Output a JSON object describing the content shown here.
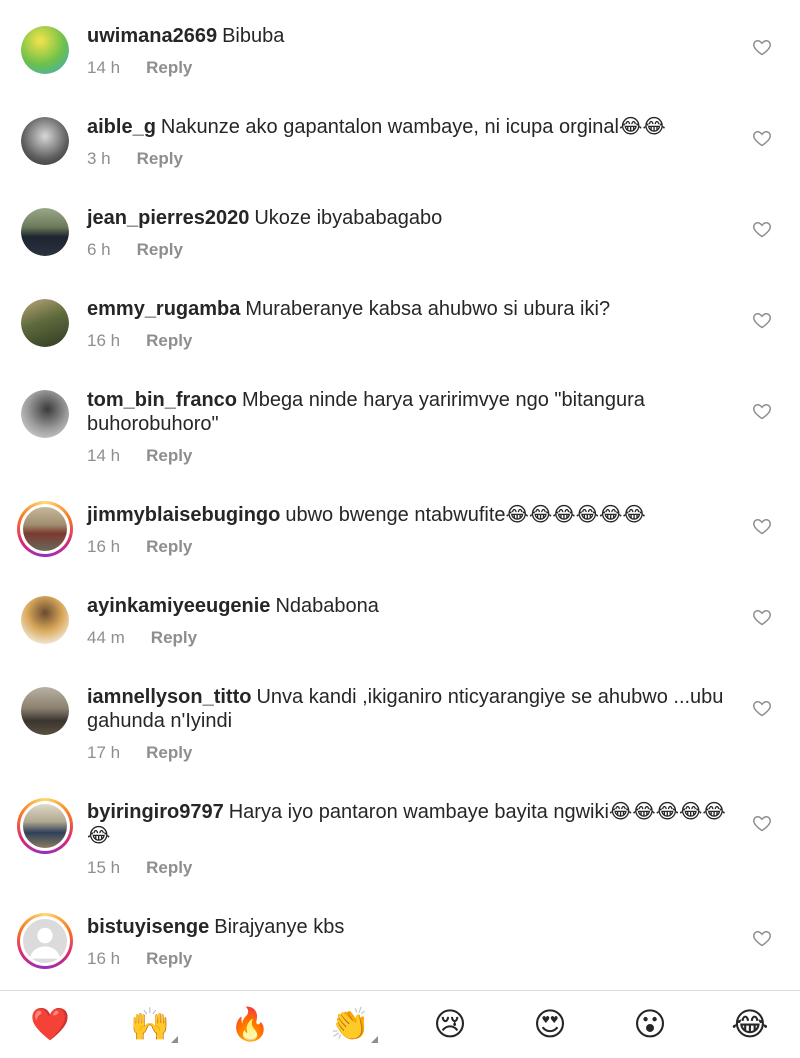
{
  "comments": [
    {
      "username": "uwimana2669",
      "text": "Bibuba",
      "time": "14 h",
      "reply": "Reply"
    },
    {
      "username": "aible_g",
      "text": "Nakunze ako gapantalon wambaye, ni icupa orginal😂😂",
      "time": "3 h",
      "reply": "Reply"
    },
    {
      "username": "jean_pierres2020",
      "text": "Ukoze ibyababagabo",
      "time": "6 h",
      "reply": "Reply"
    },
    {
      "username": "emmy_rugamba",
      "text": "Muraberanye kabsa ahubwo si ubura iki?",
      "time": "16 h",
      "reply": "Reply"
    },
    {
      "username": "tom_bin_franco",
      "text": "Mbega ninde harya yaririmvye ngo \"bitangura buhorobuhoro\"",
      "time": "14 h",
      "reply": "Reply"
    },
    {
      "username": "jimmyblaisebugingo",
      "text": "ubwo bwenge ntabwufite😂😂😂😂😂😂",
      "time": "16 h",
      "reply": "Reply"
    },
    {
      "username": "ayinkamiyeeugenie",
      "text": "Ndababona",
      "time": "44 m",
      "reply": "Reply"
    },
    {
      "username": "iamnellyson_titto",
      "text": "Unva kandi ,ikiganiro nticyarangiye se ahubwo ...ubu gahunda n'Iyindi",
      "time": "17 h",
      "reply": "Reply"
    },
    {
      "username": "byiringiro9797",
      "text": "Harya iyo pantaron wambaye bayita ngwiki😂😂😂😂😂😂",
      "time": "15 h",
      "reply": "Reply"
    },
    {
      "username": "bistuyisenge",
      "text": "Birajyanye kbs",
      "time": "16 h",
      "reply": "Reply"
    }
  ],
  "emoji_bar": [
    {
      "emoji": "❤️",
      "name": "heart"
    },
    {
      "emoji": "🙌",
      "name": "raising-hands"
    },
    {
      "emoji": "🔥",
      "name": "fire"
    },
    {
      "emoji": "👏",
      "name": "clapping-hands"
    },
    {
      "emoji": "😢",
      "name": "crying-face"
    },
    {
      "emoji": "😍",
      "name": "heart-eyes"
    },
    {
      "emoji": "😮",
      "name": "surprised-face"
    },
    {
      "emoji": "😂",
      "name": "tears-of-joy"
    }
  ],
  "icons": {
    "like": "heart-outline-icon"
  },
  "colors": {
    "text": "#262626",
    "meta": "#8e8e8e",
    "divider": "#dbdbdb"
  }
}
